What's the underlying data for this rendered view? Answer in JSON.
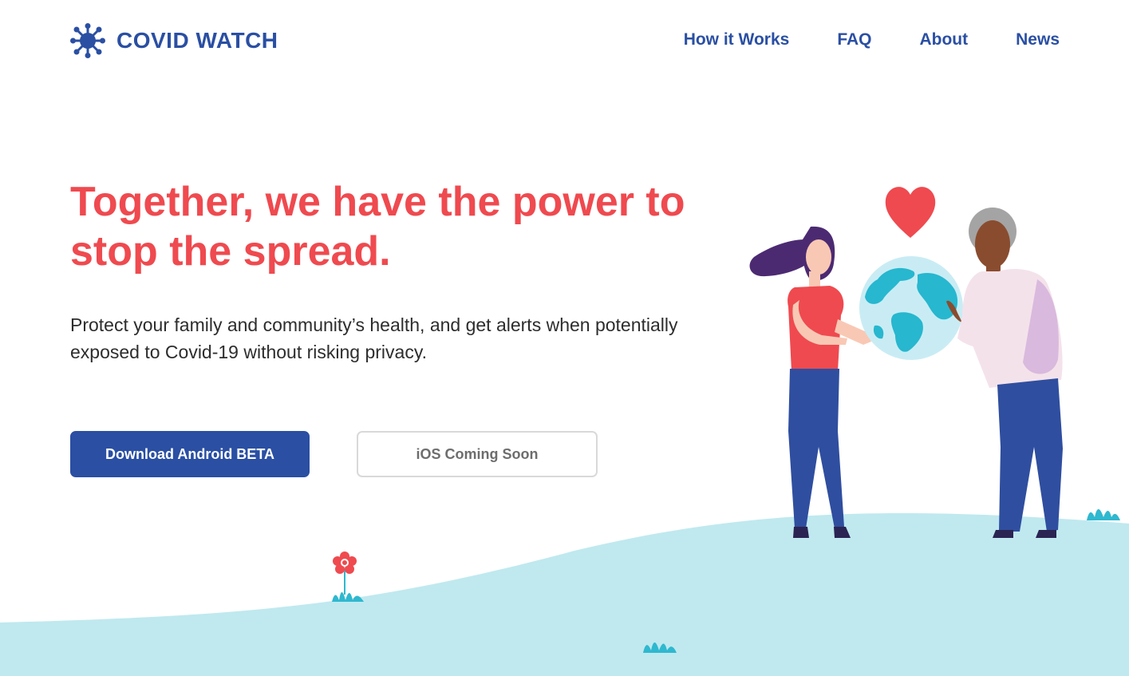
{
  "brand": {
    "name": "COVID WATCH",
    "logo": "virus-logo-icon",
    "color": "#2a4fa3"
  },
  "nav": {
    "items": [
      "How it Works",
      "FAQ",
      "About",
      "News"
    ]
  },
  "hero": {
    "title": "Together, we have the power to stop the spread.",
    "subtitle": "Protect your family and community’s health, and get alerts when potentially exposed to Covid-19 without risking privacy.",
    "title_color": "#ef4a4f"
  },
  "buttons": {
    "android": "Download Android BETA",
    "ios": "iOS Coming Soon"
  },
  "illustration": {
    "subject": "two-people-holding-globe-with-heart",
    "colors": {
      "ground": "#bfe9ef",
      "heart": "#ef4a4f",
      "globe": "#27b7cf"
    }
  }
}
